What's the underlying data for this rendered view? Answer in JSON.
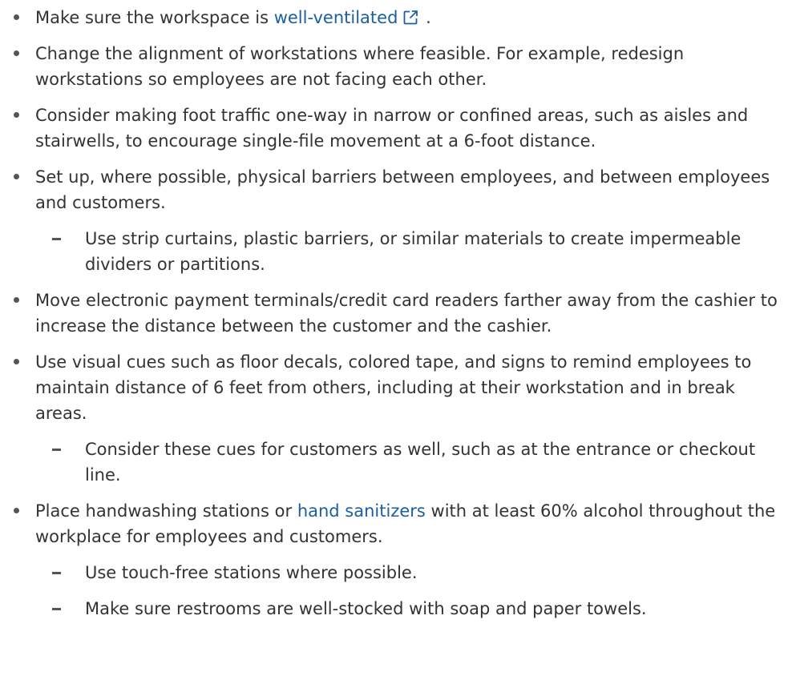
{
  "colors": {
    "text": "#333333",
    "link": "#1a5fa3",
    "bullet": "#555555"
  },
  "items": [
    {
      "before": "Make sure the workspace is ",
      "link": "well-ventilated",
      "after": " .",
      "icon": "external-link-icon"
    },
    {
      "text": "Change the alignment of workstations where feasible. For example, redesign workstations so employees are not facing each other."
    },
    {
      "text": "Consider making foot traffic one-way in narrow or confined areas, such as aisles and stairwells, to encourage single-file movement at a 6-foot distance."
    },
    {
      "text": "Set up, where possible, physical barriers between employees, and between employees and customers.",
      "subitems": [
        "Use strip curtains, plastic barriers, or similar materials to create impermeable dividers or partitions."
      ]
    },
    {
      "text": "Move electronic payment terminals/credit card readers farther away from the cashier to increase the distance between the customer and the cashier."
    },
    {
      "text": "Use visual cues such as floor decals, colored tape, and signs to remind employees to maintain distance of 6 feet from others, including at their workstation and in break areas.",
      "subitems": [
        "Consider these cues for customers as well, such as at the entrance or checkout line."
      ]
    },
    {
      "before": "Place handwashing stations or ",
      "link": "hand sanitizers",
      "after": " with at least 60% alcohol throughout the workplace for employees and customers.",
      "subitems": [
        "Use touch-free stations where possible.",
        "Make sure restrooms are well-stocked with soap and paper towels."
      ]
    }
  ]
}
